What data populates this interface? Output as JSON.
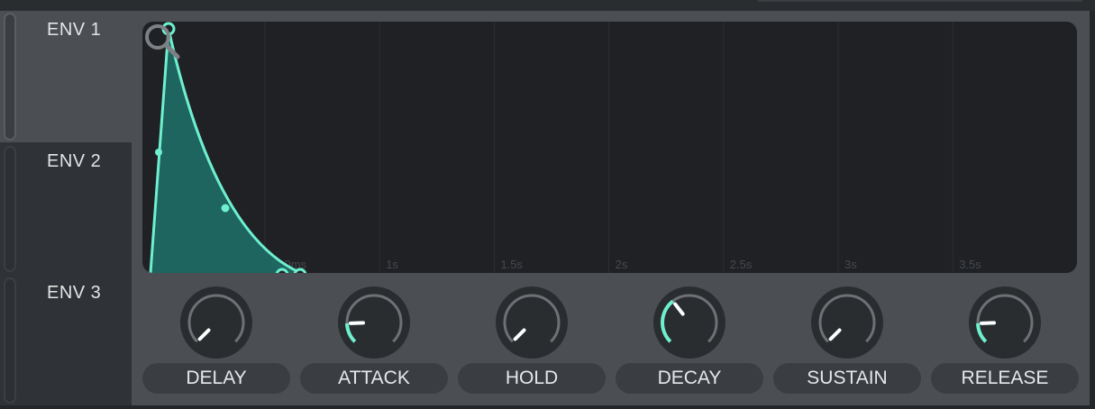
{
  "tabs": [
    {
      "label": "ENV 1",
      "selected": true
    },
    {
      "label": "ENV 2",
      "selected": false
    },
    {
      "label": "ENV 3",
      "selected": false
    }
  ],
  "graph": {
    "time_labels": [
      "500ms",
      "1s",
      "1.5s",
      "2s",
      "2.5s",
      "3s",
      "3.5s"
    ],
    "zoom_icon": "search-icon",
    "curve_color": "#6ef0cf",
    "fill_color": "#1e6b66"
  },
  "params": [
    {
      "label": "DELAY",
      "value": 0.0
    },
    {
      "label": "ATTACK",
      "value": 0.16
    },
    {
      "label": "HOLD",
      "value": 0.0
    },
    {
      "label": "DECAY",
      "value": 0.36
    },
    {
      "label": "SUSTAIN",
      "value": 0.0
    },
    {
      "label": "RELEASE",
      "value": 0.16
    }
  ],
  "colors": {
    "accent": "#6ef0cf",
    "knob_track": "#6d7175",
    "knob_body": "#2a2d30",
    "panel": "#4b4f53",
    "graph_bg": "#1f2125"
  }
}
